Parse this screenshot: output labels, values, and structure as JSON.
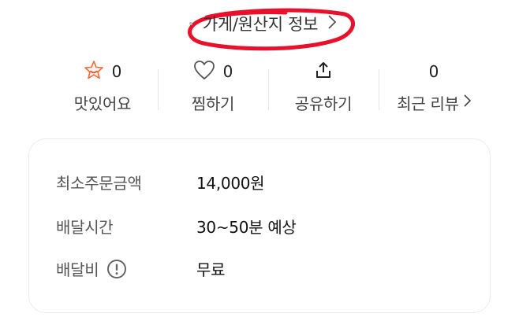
{
  "store_info_link": {
    "label": "가게/원산지 정보"
  },
  "stats": [
    {
      "count": "0",
      "label": "맛있어요",
      "icon": "star-badge-icon"
    },
    {
      "count": "0",
      "label": "찜하기",
      "icon": "heart-icon"
    },
    {
      "count": "",
      "label": "공유하기",
      "icon": "share-icon"
    },
    {
      "count": "0",
      "label": "최근 리뷰",
      "icon": "chevron-right-icon"
    }
  ],
  "delivery": {
    "rows": [
      {
        "key": "최소주문금액",
        "value": "14,000원"
      },
      {
        "key": "배달시간",
        "value": "30~50분 예상"
      },
      {
        "key": "배달비",
        "value": "무료"
      }
    ]
  },
  "colors": {
    "highlight": "#e8102a",
    "star_accent": "#f06a3a"
  }
}
